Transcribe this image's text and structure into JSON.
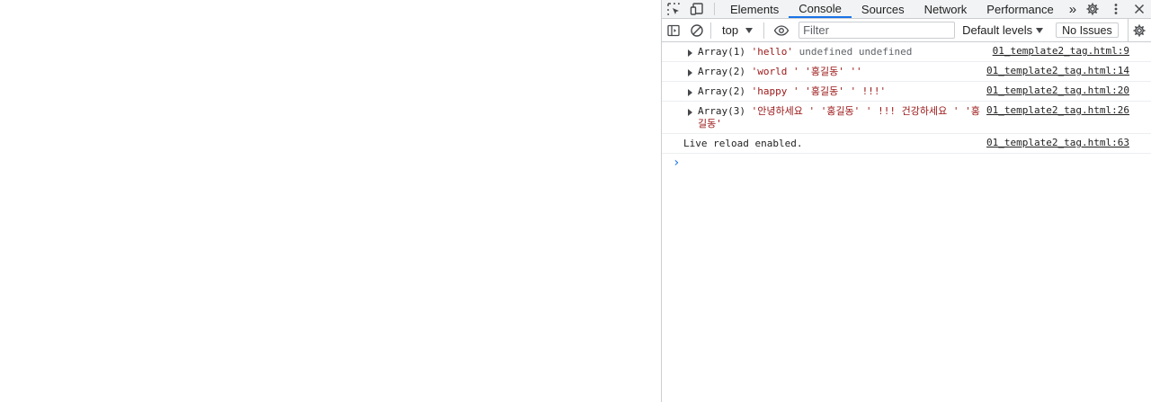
{
  "devtools": {
    "tabs": [
      {
        "label": "Elements",
        "active": false
      },
      {
        "label": "Console",
        "active": true
      },
      {
        "label": "Sources",
        "active": false
      },
      {
        "label": "Network",
        "active": false
      },
      {
        "label": "Performance",
        "active": false
      }
    ],
    "more_tabs_glyph": "»",
    "settings_icon": "gear-icon",
    "menu_icon": "kebab-menu-icon",
    "close_icon": "close-icon"
  },
  "toolbar": {
    "context": "top",
    "filter_placeholder": "Filter",
    "levels_label": "Default levels",
    "issues_label": "No Issues"
  },
  "messages": [
    {
      "type": "array",
      "expandable": true,
      "parts": [
        {
          "text": "Array(1) ",
          "kind": "plain"
        },
        {
          "text": "'hello'",
          "kind": "string"
        },
        {
          "text": " undefined undefined",
          "kind": "undef"
        }
      ],
      "source": "01_template2_tag.html:9"
    },
    {
      "type": "array",
      "expandable": true,
      "parts": [
        {
          "text": "Array(2) ",
          "kind": "plain"
        },
        {
          "text": "'world ' '홍길동' ''",
          "kind": "string"
        }
      ],
      "source": "01_template2_tag.html:14"
    },
    {
      "type": "array",
      "expandable": true,
      "parts": [
        {
          "text": "Array(2) ",
          "kind": "plain"
        },
        {
          "text": "'happy ' '홍길동' ' !!!'",
          "kind": "string"
        }
      ],
      "source": "01_template2_tag.html:20"
    },
    {
      "type": "array",
      "expandable": true,
      "parts": [
        {
          "text": "Array(3) ",
          "kind": "plain"
        },
        {
          "text": "'안녕하세요 ' '홍길동' ' !!! 건강하세요 ' '홍길동'",
          "kind": "string"
        }
      ],
      "source": "01_template2_tag.html:26"
    },
    {
      "type": "log",
      "expandable": false,
      "parts": [
        {
          "text": "Live reload enabled.",
          "kind": "plain"
        }
      ],
      "source": "01_template2_tag.html:63"
    }
  ],
  "prompt_glyph": "›",
  "colors": {
    "accent": "#1a73e8",
    "string": "#9a1616",
    "undefined": "#5f6368",
    "border": "#cbcdd1"
  }
}
